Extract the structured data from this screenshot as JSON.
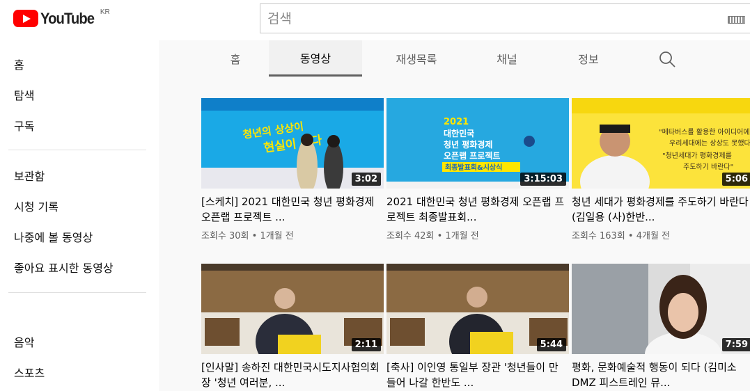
{
  "header": {
    "logo_text": "YouTube",
    "logo_region": "KR",
    "search_placeholder": "검색",
    "keyboard_icon": "keyboard-icon"
  },
  "sidebar": {
    "items": [
      {
        "label": "홈"
      },
      {
        "label": "탐색"
      },
      {
        "label": "구독"
      },
      {
        "label": "보관함"
      },
      {
        "label": "시청 기록"
      },
      {
        "label": "나중에 볼 동영상"
      },
      {
        "label": "좋아요 표시한 동영상"
      },
      {
        "label": "음악"
      },
      {
        "label": "스포츠"
      }
    ]
  },
  "tabs": {
    "items": [
      {
        "label": "홈"
      },
      {
        "label": "동영상"
      },
      {
        "label": "재생목록"
      },
      {
        "label": "채널"
      },
      {
        "label": "정보"
      }
    ],
    "active": "동영상",
    "search_icon": "search-icon"
  },
  "videos": [
    {
      "duration": "3:02",
      "title": "[스케치] 2021 대한민국 청년 평화경제 오픈랩 프로젝트 ...",
      "meta": "조회수 30회 • 1개월 전",
      "thumb_text": "청년의 상상이 현실이 된다"
    },
    {
      "duration": "3:15:03",
      "title": "2021 대한민국 청년 평화경제 오픈랩 프로젝트 최종발표회...",
      "meta": "조회수 42회 • 1개월 전",
      "thumb_text": "2021 대한민국 청년 평화경제 오픈랩 프로젝트 최종발표회&시상식"
    },
    {
      "duration": "5:06",
      "title": "청년 세대가 평화경제를 주도하기 바란다(김일용 (사)한반...",
      "meta": "조회수 163회 • 4개월 전",
      "thumb_text": "\"메타버스를 활용한 아이디어에 우리세대에는 상상도 못했다\" \"청년세대가 평화경제를 주도하기 바란다\""
    },
    {
      "duration": "2:11",
      "title": "[인사말] 송하진 대한민국시도지사협의회장 '청년 여러분, ...",
      "meta": "",
      "thumb_text": ""
    },
    {
      "duration": "5:44",
      "title": "[축사] 이인영 통일부 장관 '청년들이 만들어 나갈 한반도 ...",
      "meta": "",
      "thumb_text": ""
    },
    {
      "duration": "7:59",
      "title": "평화, 문화예술적 행동이 되다 (김미소 DMZ 피스트레인 뮤...",
      "meta": "",
      "thumb_text": ""
    }
  ],
  "colors": {
    "brand_red": "#ff0000",
    "tab_bg": "#f9f9f9",
    "meta_text": "#606060"
  }
}
